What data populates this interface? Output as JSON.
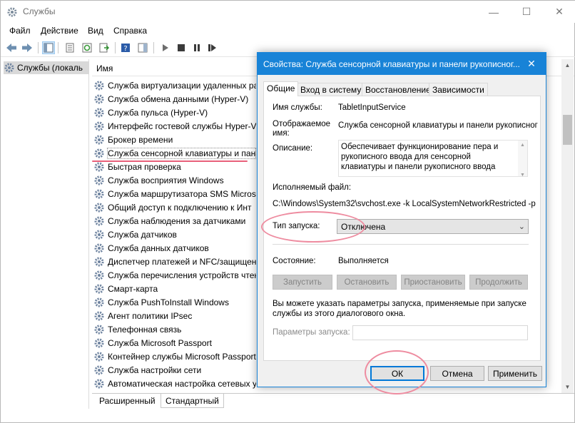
{
  "window": {
    "title": "Службы",
    "icon": "gear-icon"
  },
  "menu": [
    "Файл",
    "Действие",
    "Вид",
    "Справка"
  ],
  "tree": {
    "root_label": "Службы (локаль"
  },
  "list": {
    "column_header": "Имя",
    "rows": [
      "Служба виртуализации удаленных ра",
      "Служба обмена данными (Hyper-V)",
      "Служба пульса (Hyper-V)",
      "Интерфейс гостевой службы Hyper-V",
      "Брокер времени",
      "Служба сенсорной клавиатуры и пан",
      "Быстрая проверка",
      "Служба восприятия Windows",
      "Служба маршрутизатора SMS Micros",
      "Общий доступ к подключению к Инт",
      "Служба наблюдения за датчиками",
      "Служба датчиков",
      "Служба данных датчиков",
      "Диспетчер платежей и NFC/защищен",
      "Служба перечисления устройств чтен",
      "Смарт-карта",
      "Служба PushToInstall Windows",
      "Агент политики IPsec",
      "Телефонная связь",
      "Служба Microsoft Passport",
      "Контейнер службы Microsoft Passport",
      "Служба настройки сети",
      "Автоматическая настройка сетевых у"
    ],
    "selected_index": 5
  },
  "bottom_tabs": [
    "Расширенный",
    "Стандартный"
  ],
  "dialog": {
    "title": "Свойства: Служба сенсорной клавиатуры и панели рукописног...",
    "close": "✕",
    "tabs": [
      "Общие",
      "Вход в систему",
      "Восстановление",
      "Зависимости"
    ],
    "service_name_label": "Имя службы:",
    "service_name_value": "TabletInputService",
    "display_name_label_1": "Отображаемое",
    "display_name_label_2": "имя:",
    "display_name_value": "Служба сенсорной клавиатуры и панели рукописног",
    "description_label": "Описание:",
    "description_value": "Обеспечивает функционирование пера и рукописного ввода для сенсорной клавиатуры и панели рукописного ввода",
    "executable_label": "Исполняемый файл:",
    "executable_value": "C:\\Windows\\System32\\svchost.exe -k LocalSystemNetworkRestricted -p",
    "startup_type_label": "Тип запуска:",
    "startup_type_value": "Отключена",
    "status_label": "Состояние:",
    "status_value": "Выполняется",
    "buttons_control": [
      "Запустить",
      "Остановить",
      "Приостановить",
      "Продолжить"
    ],
    "hint": "Вы можете указать параметры запуска, применяемые при запуске службы из этого диалогового окна.",
    "params_label": "Параметры запуска:",
    "ok": "ОК",
    "cancel": "Отмена",
    "apply": "Применить"
  },
  "colors": {
    "dialog_title_bg": "#1883d7",
    "annotation": "#ee8ca0",
    "selection": "#d9d9d9"
  }
}
